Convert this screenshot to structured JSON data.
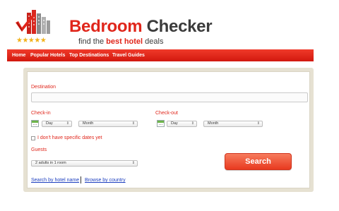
{
  "brand": {
    "title_word1": "Bedroom",
    "title_word2": "Checker",
    "tagline_part1": "find the ",
    "tagline_highlight": "best hotel",
    "tagline_part2": " deals",
    "stars": "★★★★★"
  },
  "nav": {
    "items": [
      {
        "label": "Home"
      },
      {
        "label": "Popular Hotels"
      },
      {
        "label": "Top Destinations"
      },
      {
        "label": "Travel Guides"
      }
    ]
  },
  "form": {
    "destination_label": "Destination",
    "destination_value": "",
    "checkin": {
      "label": "Check-in",
      "day": "Day",
      "month": "Month"
    },
    "checkout": {
      "label": "Check-out",
      "day": "Day",
      "month": "Month"
    },
    "no_dates_label": "I don't have specific dates yet",
    "no_dates_checked": false,
    "guests_label": "Guests",
    "guests_value": "2 adults in 1 room",
    "search_button": "Search"
  },
  "links": {
    "by_name": "Search by hotel name",
    "by_country": "Browse by country"
  },
  "colors": {
    "brand_red": "#e0261b",
    "nav_red": "#e4261a",
    "link_blue": "#1d3fbf",
    "panel_beige": "#e6e1d2"
  },
  "icons": {
    "logo": "hotel-checkmark-logo",
    "calendar": "calendar-icon",
    "select_arrow": "updown-arrow-icon"
  }
}
